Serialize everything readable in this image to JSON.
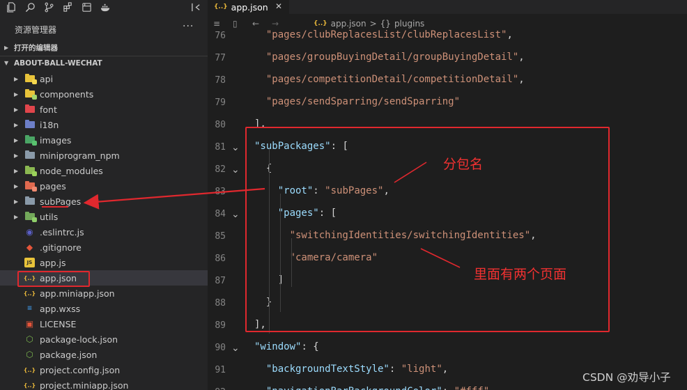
{
  "sidebar": {
    "title": "资源管理器",
    "more": "···",
    "sections": [
      {
        "label": "打开的编辑器",
        "expanded": false
      },
      {
        "label": "ABOUT-BALL-WECHAT",
        "expanded": true
      }
    ],
    "items": [
      {
        "label": "api",
        "kind": "folder",
        "color": "#e8c33a",
        "badge": "#f4d74e"
      },
      {
        "label": "components",
        "kind": "folder",
        "color": "#e8c33a",
        "badge": "#a5d66c"
      },
      {
        "label": "font",
        "kind": "folder-red",
        "color": "#e0454b",
        "glyph": "A"
      },
      {
        "label": "i18n",
        "kind": "folder",
        "color": "#6d7fc8",
        "glyph": "文"
      },
      {
        "label": "images",
        "kind": "folder",
        "color": "#4aa565",
        "badge": "#59c26f"
      },
      {
        "label": "miniprogram_npm",
        "kind": "folder",
        "color": "#8a9aa9"
      },
      {
        "label": "node_modules",
        "kind": "folder",
        "color": "#8bb851",
        "badge": "#9cd25b"
      },
      {
        "label": "pages",
        "kind": "folder",
        "color": "#e06a4f",
        "badge": "#f08a70"
      },
      {
        "label": "subPages",
        "kind": "folder",
        "color": "#8a9aa9"
      },
      {
        "label": "utils",
        "kind": "folder",
        "color": "#73a85a",
        "badge": "#8fcf6a"
      },
      {
        "label": ".eslintrc.js",
        "kind": "file",
        "icon": "eslint",
        "color": "#5b5fc7"
      },
      {
        "label": ".gitignore",
        "kind": "file",
        "icon": "git",
        "color": "#e4553a"
      },
      {
        "label": "app.js",
        "kind": "file",
        "icon": "js",
        "color": "#e8c33a"
      },
      {
        "label": "app.json",
        "kind": "file",
        "icon": "json",
        "color": "#e8b73a",
        "selected": true
      },
      {
        "label": "app.miniapp.json",
        "kind": "file",
        "icon": "json",
        "color": "#e8b73a"
      },
      {
        "label": "app.wxss",
        "kind": "file",
        "icon": "css",
        "color": "#3d8fd6"
      },
      {
        "label": "LICENSE",
        "kind": "file",
        "icon": "license",
        "color": "#e4553a"
      },
      {
        "label": "package-lock.json",
        "kind": "file",
        "icon": "node",
        "color": "#7cb84f"
      },
      {
        "label": "package.json",
        "kind": "file",
        "icon": "node",
        "color": "#7cb84f"
      },
      {
        "label": "project.config.json",
        "kind": "file",
        "icon": "json",
        "color": "#e8b73a"
      },
      {
        "label": "project.miniapp.json",
        "kind": "file",
        "icon": "json",
        "color": "#e8b73a"
      }
    ]
  },
  "tab": {
    "icon": "{..}",
    "label": "app.json",
    "close": "✕"
  },
  "breadcrumb": {
    "icon": "{..}",
    "file": "app.json",
    "sep": ">",
    "braces": "{}",
    "node": "plugins"
  },
  "editor": {
    "lines": [
      {
        "n": "76",
        "text": "  \"pages/clubReplacesList/clubReplacesList\",",
        "fold": false
      },
      {
        "n": "77",
        "text": "  \"pages/groupBuyingDetail/groupBuyingDetail\",",
        "fold": false
      },
      {
        "n": "78",
        "text": "  \"pages/competitionDetail/competitionDetail\",",
        "fold": false
      },
      {
        "n": "79",
        "text": "  \"pages/sendSparring/sendSparring\"",
        "fold": false
      },
      {
        "n": "80",
        "text": "],",
        "fold": false
      },
      {
        "n": "81",
        "text": "\"subPackages\": [",
        "fold": true
      },
      {
        "n": "82",
        "text": "  {",
        "fold": true
      },
      {
        "n": "83",
        "text": "    \"root\": \"subPages\",",
        "fold": false
      },
      {
        "n": "84",
        "text": "    \"pages\": [",
        "fold": true
      },
      {
        "n": "85",
        "text": "      \"switchingIdentities/switchingIdentities\",",
        "fold": false
      },
      {
        "n": "86",
        "text": "      \"camera/camera\"",
        "fold": false
      },
      {
        "n": "87",
        "text": "    ]",
        "fold": false
      },
      {
        "n": "88",
        "text": "  }",
        "fold": false
      },
      {
        "n": "89",
        "text": "],",
        "fold": false
      },
      {
        "n": "90",
        "text": "\"window\": {",
        "fold": true
      },
      {
        "n": "91",
        "text": "  \"backgroundTextStyle\": \"light\",",
        "fold": false
      },
      {
        "n": "92",
        "text": "  \"navigationBarBackgroundColor\": \"#fff\",",
        "fold": false
      }
    ]
  },
  "annotations": {
    "package_name": "分包名",
    "two_pages": "里面有两个页面",
    "color": "#e0282e"
  },
  "watermark": "CSDN @劝导小子"
}
